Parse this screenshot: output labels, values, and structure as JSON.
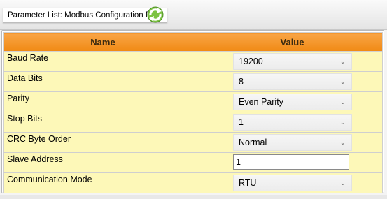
{
  "header": {
    "title": "Parameter List: Modbus Configuration Data",
    "refresh_icon": "refresh-icon"
  },
  "grid": {
    "columns": [
      "Name",
      "Value"
    ],
    "rows": [
      {
        "name": "Baud Rate",
        "value": "19200",
        "control": "dropdown"
      },
      {
        "name": "Data Bits",
        "value": "8",
        "control": "dropdown"
      },
      {
        "name": "Parity",
        "value": "Even Parity",
        "control": "dropdown"
      },
      {
        "name": "Stop Bits",
        "value": "1",
        "control": "dropdown"
      },
      {
        "name": "CRC Byte Order",
        "value": "Normal",
        "control": "dropdown"
      },
      {
        "name": "Slave Address",
        "value": "1",
        "control": "textbox"
      },
      {
        "name": "Communication Mode",
        "value": "RTU",
        "control": "dropdown"
      }
    ]
  },
  "colors": {
    "header_orange": "#f08a14",
    "row_yellow": "#fdf8b8"
  }
}
